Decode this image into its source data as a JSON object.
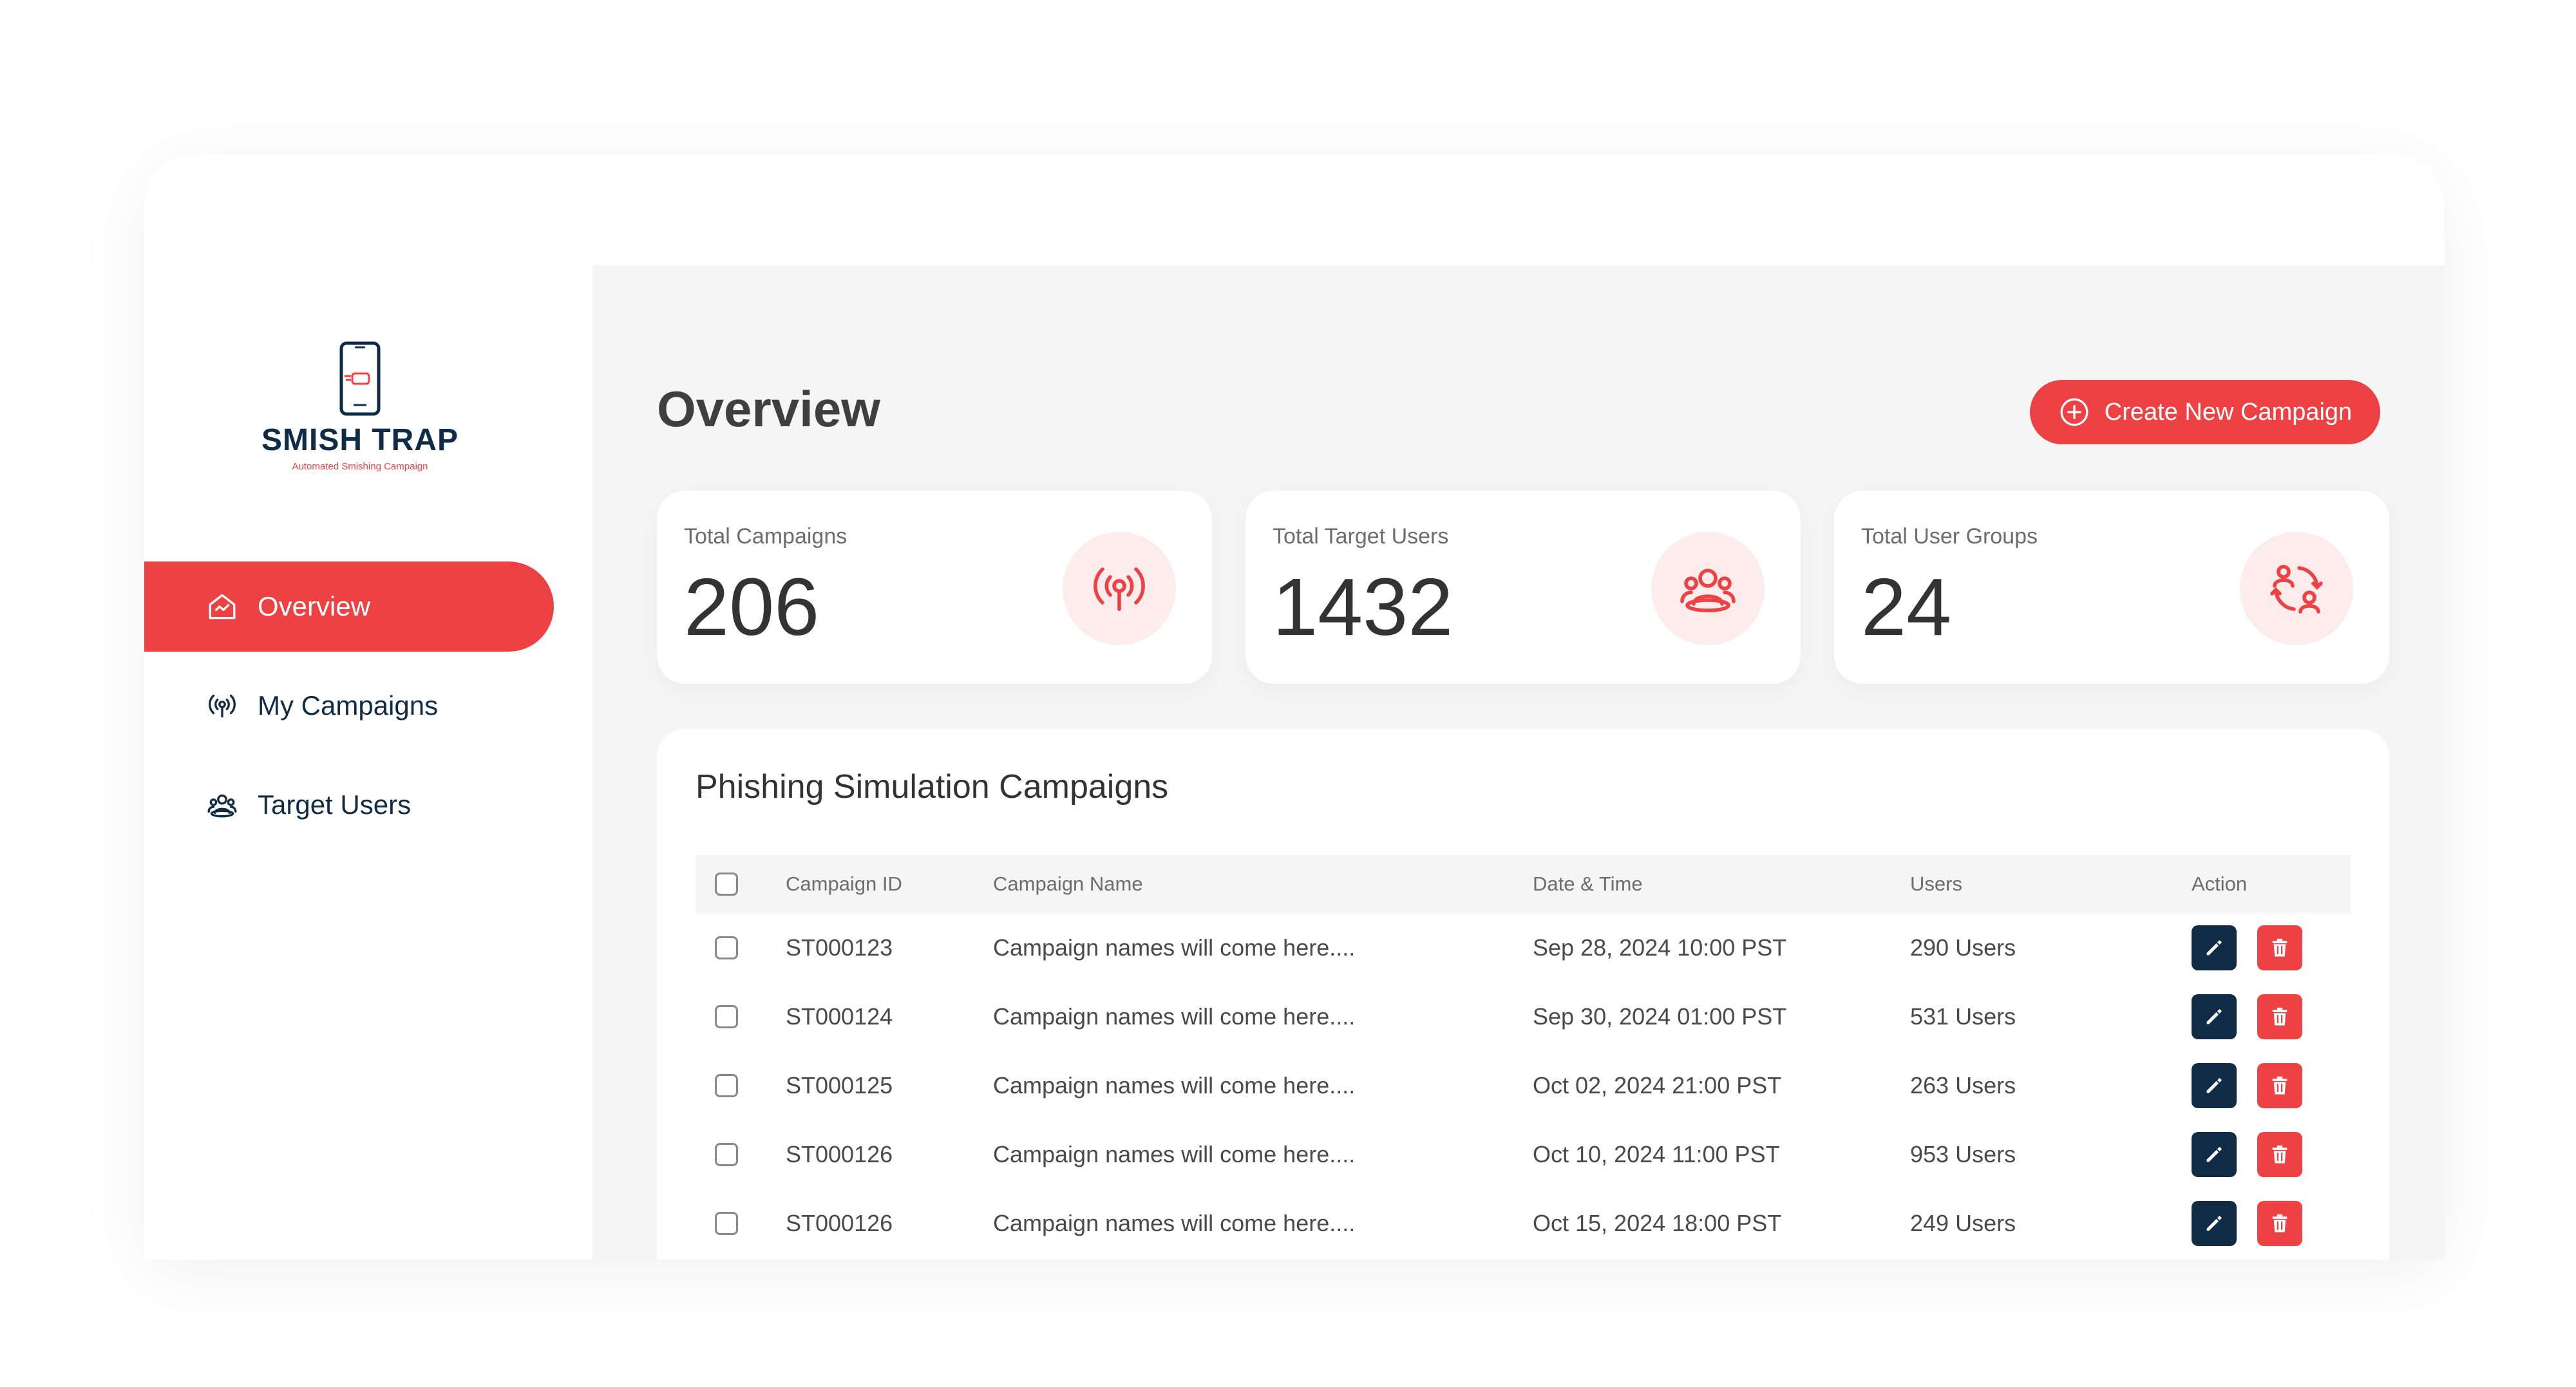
{
  "brand": {
    "title": "SMISH TRAP",
    "subtitle": "Automated Smishing Campaign"
  },
  "sidebar": {
    "items": [
      {
        "label": "Overview",
        "icon": "dashboard-icon",
        "active": true
      },
      {
        "label": "My Campaigns",
        "icon": "broadcast-icon",
        "active": false
      },
      {
        "label": "Target Users",
        "icon": "users-icon",
        "active": false
      }
    ]
  },
  "header": {
    "title": "Overview",
    "create_label": "Create New Campaign"
  },
  "stats": [
    {
      "label": "Total Campaigns",
      "value": "206",
      "icon": "broadcast-icon"
    },
    {
      "label": "Total Target Users",
      "value": "1432",
      "icon": "users-icon"
    },
    {
      "label": "Total User Groups",
      "value": "24",
      "icon": "user-groups-icon"
    }
  ],
  "table": {
    "title": "Phishing Simulation Campaigns",
    "columns": [
      "Campaign ID",
      "Campaign Name",
      "Date & Time",
      "Users",
      "Action"
    ],
    "rows": [
      {
        "id": "ST000123",
        "name": "Campaign names will come here....",
        "date": "Sep 28, 2024 10:00 PST",
        "users": "290 Users"
      },
      {
        "id": "ST000124",
        "name": "Campaign names will come here....",
        "date": "Sep 30, 2024 01:00 PST",
        "users": "531 Users"
      },
      {
        "id": "ST000125",
        "name": "Campaign names will come here....",
        "date": "Oct 02, 2024 21:00 PST",
        "users": "263 Users"
      },
      {
        "id": "ST000126",
        "name": "Campaign names will come here....",
        "date": "Oct 10, 2024 11:00 PST",
        "users": "953 Users"
      },
      {
        "id": "ST000126",
        "name": "Campaign names will come here....",
        "date": "Oct 15, 2024 18:00 PST",
        "users": "249 Users"
      }
    ]
  },
  "colors": {
    "accent": "#EE4143",
    "navy": "#0F2B45",
    "background": "#F5F5F5"
  }
}
